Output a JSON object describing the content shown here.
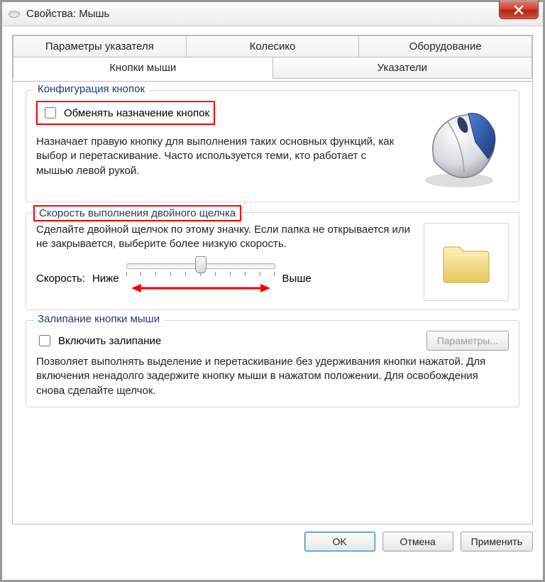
{
  "window": {
    "title": "Свойства: Мышь"
  },
  "tabs": {
    "row1": [
      "Параметры указателя",
      "Колесико",
      "Оборудование"
    ],
    "row2": [
      "Кнопки мыши",
      "Указатели"
    ],
    "active": "Кнопки мыши"
  },
  "group_buttons": {
    "legend": "Конфигурация кнопок",
    "swap_label": "Обменять назначение кнопок",
    "swap_checked": false,
    "desc": "Назначает правую кнопку для выполнения таких основных функций, как выбор и перетаскивание. Часто используется теми, кто работает с мышью левой рукой."
  },
  "group_doubleclick": {
    "legend": "Скорость выполнения двойного щелчка",
    "desc": "Сделайте двойной щелчок по этому значку. Если папка не открывается или не закрывается, выберите более низкую скорость.",
    "speed_label": "Скорость:",
    "low_label": "Ниже",
    "high_label": "Выше"
  },
  "group_clicklock": {
    "legend": "Залипание кнопки мыши",
    "enable_label": "Включить залипание",
    "enable_checked": false,
    "params_button": "Параметры...",
    "desc": "Позволяет выполнять выделение и перетаскивание без удерживания кнопки нажатой. Для включения ненадолго задержите кнопку мыши в нажатом положении. Для освобождения снова сделайте щелчок."
  },
  "footer": {
    "ok": "OK",
    "cancel": "Отмена",
    "apply": "Применить"
  },
  "icons": {
    "mouse": "mouse-icon",
    "folder": "folder-icon"
  }
}
